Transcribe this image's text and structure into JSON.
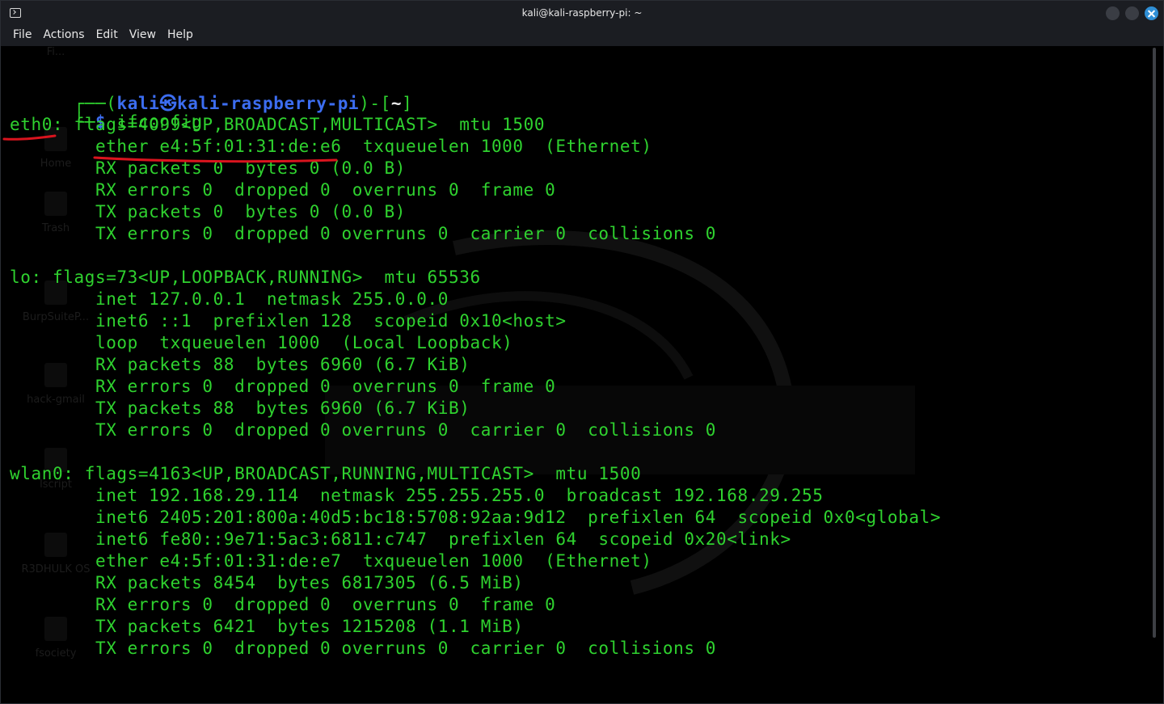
{
  "window": {
    "title": "kali@kali-raspberry-pi: ~"
  },
  "menu": {
    "file": "File",
    "actions": "Actions",
    "edit": "Edit",
    "view": "View",
    "help": "Help"
  },
  "desktop_icons": [
    "Fi...",
    "Home",
    "Trash",
    "BurpSuiteP...",
    "hack-gmail",
    "lscript",
    "R3DHULK OS",
    "fsociety"
  ],
  "prompt": {
    "user": "kali",
    "at_symbol": "㉿",
    "host": "kali-raspberry-pi",
    "dir": "~",
    "dollar": "$",
    "command": "ifconfig"
  },
  "output": [
    "eth0: flags=4099<UP,BROADCAST,MULTICAST>  mtu 1500",
    "        ether e4:5f:01:31:de:e6  txqueuelen 1000  (Ethernet)",
    "        RX packets 0  bytes 0 (0.0 B)",
    "        RX errors 0  dropped 0  overruns 0  frame 0",
    "        TX packets 0  bytes 0 (0.0 B)",
    "        TX errors 0  dropped 0 overruns 0  carrier 0  collisions 0",
    "",
    "lo: flags=73<UP,LOOPBACK,RUNNING>  mtu 65536",
    "        inet 127.0.0.1  netmask 255.0.0.0",
    "        inet6 ::1  prefixlen 128  scopeid 0x10<host>",
    "        loop  txqueuelen 1000  (Local Loopback)",
    "        RX packets 88  bytes 6960 (6.7 KiB)",
    "        RX errors 0  dropped 0  overruns 0  frame 0",
    "        TX packets 88  bytes 6960 (6.7 KiB)",
    "        TX errors 0  dropped 0 overruns 0  carrier 0  collisions 0",
    "",
    "wlan0: flags=4163<UP,BROADCAST,RUNNING,MULTICAST>  mtu 1500",
    "        inet 192.168.29.114  netmask 255.255.255.0  broadcast 192.168.29.255",
    "        inet6 2405:201:800a:40d5:bc18:5708:92aa:9d12  prefixlen 64  scopeid 0x0<global>",
    "        inet6 fe80::9e71:5ac3:6811:c747  prefixlen 64  scopeid 0x20<link>",
    "        ether e4:5f:01:31:de:e7  txqueuelen 1000  (Ethernet)",
    "        RX packets 8454  bytes 6817305 (6.5 MiB)",
    "        RX errors 0  dropped 0  overruns 0  frame 0",
    "        TX packets 6421  bytes 1215208 (1.1 MiB)",
    "        TX errors 0  dropped 0 overruns 0  carrier 0  collisions 0"
  ],
  "colors": {
    "terminal_green": "#2fd22f",
    "prompt_blue": "#3c6df0",
    "annotation_red": "#d9141e"
  }
}
